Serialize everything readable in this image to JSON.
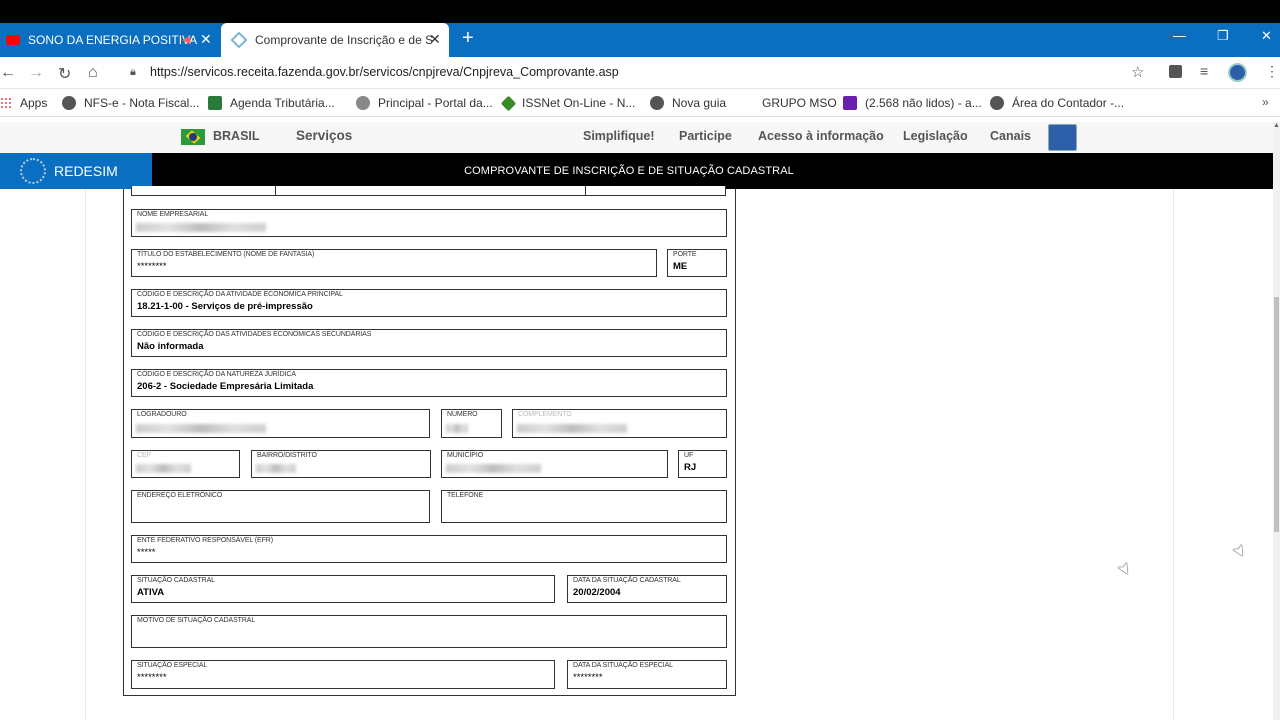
{
  "browser": {
    "tabs": [
      {
        "label": "SONO DA ENERGIA POSITIVA",
        "close": "✕"
      },
      {
        "label": "Comprovante de Inscrição e de S",
        "close": "✕"
      }
    ],
    "new_tab": "+",
    "window_controls": {
      "minimize": "—",
      "restore": "❐",
      "close": "✕"
    },
    "url": "https://servicos.receita.fazenda.gov.br/servicos/cnpjreva/Cnpjreva_Comprovante.asp",
    "bookmarks": [
      {
        "label": "Apps",
        "icon": "apps-grid-icon"
      },
      {
        "label": "NFS-e - Nota Fiscal...",
        "icon": "globe-icon"
      },
      {
        "label": "Agenda Tributária...",
        "icon": "agenda-icon"
      },
      {
        "label": "Principal - Portal da...",
        "icon": "portal-icon"
      },
      {
        "label": "ISSNet On-Line - N...",
        "icon": "issnet-icon"
      },
      {
        "label": "Nova guia",
        "icon": "globe-icon"
      },
      {
        "label": "GRUPO MSO",
        "icon": ""
      },
      {
        "label": "(2.568 não lidos) - a...",
        "icon": "yahoo-mail-icon"
      },
      {
        "label": "Área do Contador -...",
        "icon": "globe-icon"
      }
    ]
  },
  "govbar": {
    "country": "BRASIL",
    "services": "Serviços",
    "links": [
      "Simplifique!",
      "Participe",
      "Acesso à informação",
      "Legislação",
      "Canais"
    ]
  },
  "header": {
    "logo": "REDESIM",
    "title": "COMPROVANTE DE INSCRIÇÃO E DE SITUAÇÃO CADASTRAL"
  },
  "form": {
    "nome_empresarial": {
      "label": "NOME EMPRESARIAL",
      "value": ""
    },
    "titulo": {
      "label": "TÍTULO DO ESTABELECIMENTO (NOME DE FANTASIA)",
      "value": "********"
    },
    "porte": {
      "label": "PORTE",
      "value": "ME"
    },
    "atividade_principal": {
      "label": "CÓDIGO E DESCRIÇÃO DA ATIVIDADE ECONÔMICA PRINCIPAL",
      "value": "18.21-1-00 - Serviços de pré-impressão"
    },
    "atividades_secundarias": {
      "label": "CÓDIGO E DESCRIÇÃO DAS ATIVIDADES ECONÔMICAS SECUNDÁRIAS",
      "value": "Não informada"
    },
    "natureza_juridica": {
      "label": "CÓDIGO E DESCRIÇÃO DA NATUREZA JURÍDICA",
      "value": "206-2 - Sociedade Empresária Limitada"
    },
    "logradouro": {
      "label": "LOGRADOURO",
      "value": ""
    },
    "numero": {
      "label": "NÚMERO",
      "value": ""
    },
    "complemento": {
      "label": "COMPLEMENTO",
      "value": ""
    },
    "cep": {
      "label": "CEP",
      "value": ""
    },
    "bairro": {
      "label": "BAIRRO/DISTRITO",
      "value": ""
    },
    "municipio": {
      "label": "MUNICÍPIO",
      "value": ""
    },
    "uf": {
      "label": "UF",
      "value": "RJ"
    },
    "email": {
      "label": "ENDEREÇO ELETRÔNICO",
      "value": ""
    },
    "telefone": {
      "label": "TELEFONE",
      "value": ""
    },
    "efr": {
      "label": "ENTE FEDERATIVO RESPONSÁVEL (EFR)",
      "value": "*****"
    },
    "situacao": {
      "label": "SITUAÇÃO CADASTRAL",
      "value": "ATIVA"
    },
    "data_situacao": {
      "label": "DATA DA SITUAÇÃO CADASTRAL",
      "value": "20/02/2004"
    },
    "motivo": {
      "label": "MOTIVO DE SITUAÇÃO CADASTRAL",
      "value": ""
    },
    "situacao_especial": {
      "label": "SITUAÇÃO ESPECIAL",
      "value": "********"
    },
    "data_situacao_especial": {
      "label": "DATA DA SITUAÇÃO ESPECIAL",
      "value": "********"
    }
  }
}
